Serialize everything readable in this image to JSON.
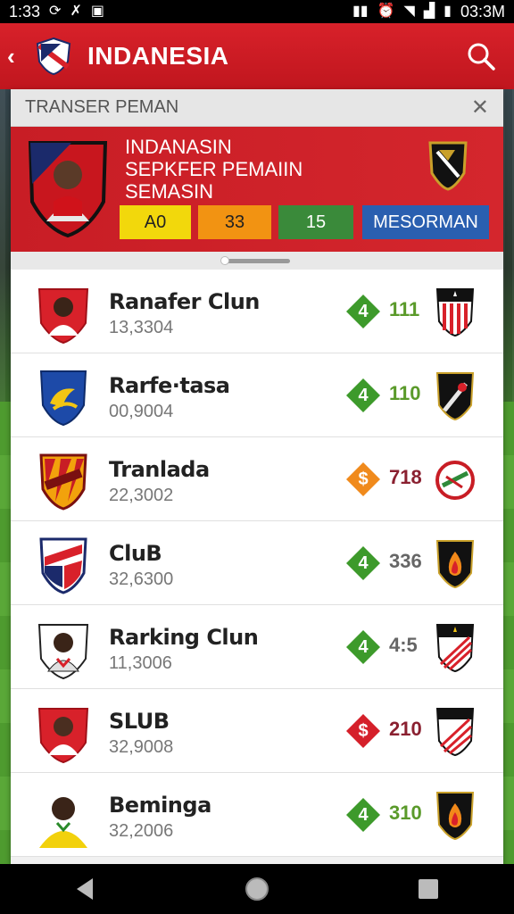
{
  "status_bar": {
    "time_left": "1:33",
    "time_right": "03:3M"
  },
  "header": {
    "title": "INDANESIA"
  },
  "panel": {
    "heading": "TRANSER PEMAN",
    "feature": {
      "lines": [
        "INDANASIN",
        "SEPKFER PEMAIIN",
        "SEMASIN"
      ],
      "stats": [
        "A0",
        "33",
        "15",
        "MESORMAN"
      ]
    }
  },
  "rows": [
    {
      "name": "Ranafer Clun",
      "sub": "13,3304",
      "badge": "4",
      "badge_color": "#3d9a2b",
      "value": "111",
      "value_color": "#5a9a2a"
    },
    {
      "name": "Rarfe·tasa",
      "sub": "00,9004",
      "badge": "4",
      "badge_color": "#3d9a2b",
      "value": "110",
      "value_color": "#5a9a2a"
    },
    {
      "name": "Tranlada",
      "sub": "22,3002",
      "badge": "$",
      "badge_color": "#f08a1c",
      "value": "718",
      "value_color": "#8a2030"
    },
    {
      "name": "CluB",
      "sub": "32,6300",
      "badge": "4",
      "badge_color": "#3d9a2b",
      "value": "336",
      "value_color": "#666666"
    },
    {
      "name": "Rarking Clun",
      "sub": "11,3006",
      "badge": "4",
      "badge_color": "#3d9a2b",
      "value": "4:5",
      "value_color": "#666666"
    },
    {
      "name": "SLUB",
      "sub": "32,9008",
      "badge": "$",
      "badge_color": "#d5202a",
      "value": "210",
      "value_color": "#8a2030"
    },
    {
      "name": "Beminga",
      "sub": "32,2006",
      "badge": "4",
      "badge_color": "#3d9a2b",
      "value": "310",
      "value_color": "#5a9a2a"
    }
  ],
  "colors": {
    "header_red": "#d8212a",
    "accent_green": "#3d9a2b"
  }
}
